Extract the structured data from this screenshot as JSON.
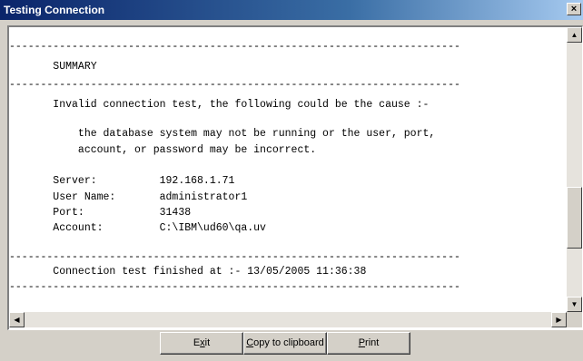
{
  "window": {
    "title": "Testing Connection",
    "close_glyph": "×"
  },
  "report": {
    "lines": [
      "------------------------------------------------------------------------",
      "       SUMMARY",
      "------------------------------------------------------------------------",
      "       Invalid connection test, the following could be the cause :-",
      "           the database system may not be running or the user, port,",
      "           account, or password may be incorrect.",
      "       Server:          192.168.1.71",
      "       User Name:       administrator1",
      "       Port:            31438",
      "       Account:         C:\\IBM\\ud60\\qa.uv",
      "------------------------------------------------------------------------",
      "       Connection test finished at :- 13/05/2005 11:36:38",
      "------------------------------------------------------------------------"
    ]
  },
  "scrollbars": {
    "up_arrow": "▲",
    "down_arrow": "▼",
    "left_arrow": "◀",
    "right_arrow": "▶",
    "vertical_thumb_fraction": 0.75
  },
  "buttons": {
    "exit": {
      "mnemonic": "x",
      "pre": "E",
      "post": "it"
    },
    "copy": {
      "mnemonic": "C",
      "pre": "",
      "post": "opy to clipboard"
    },
    "print": {
      "mnemonic": "P",
      "pre": "",
      "post": "rint"
    }
  }
}
